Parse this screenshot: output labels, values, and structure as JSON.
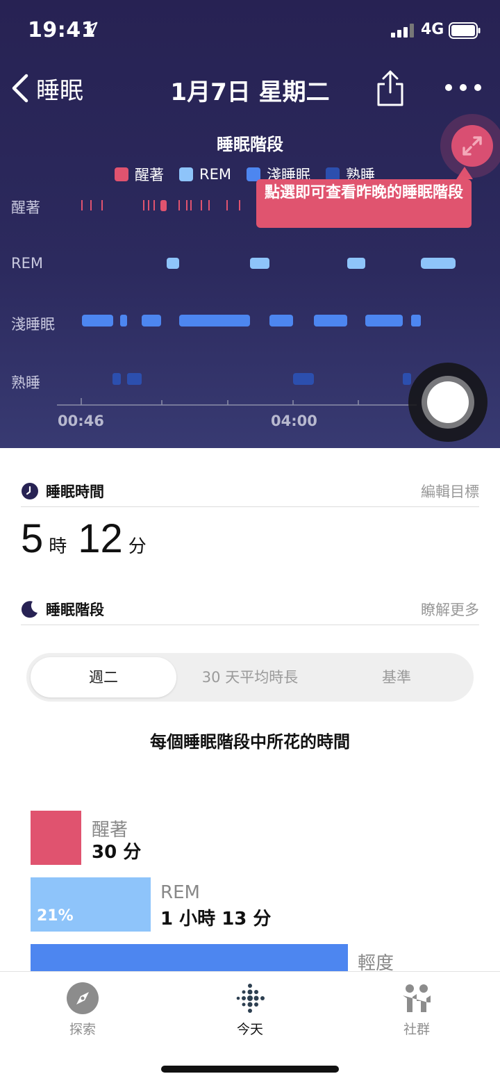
{
  "status_bar": {
    "time": "19:41",
    "network": "4G"
  },
  "nav": {
    "back_label": "睡眠",
    "title": "1月7日 星期二"
  },
  "hypnogram": {
    "title": "睡眠階段",
    "legend": [
      {
        "label": "醒著",
        "color": "#e0536f"
      },
      {
        "label": "REM",
        "color": "#8ec4fa"
      },
      {
        "label": "淺睡眠",
        "color": "#4d86f0"
      },
      {
        "label": "熟睡",
        "color": "#2c4fae"
      }
    ],
    "stage_labels": [
      "醒著",
      "REM",
      "淺睡眠",
      "熟睡"
    ],
    "time_ticks": [
      "00:46",
      "04:00"
    ],
    "tooltip": "點選即可查看昨晚的睡眠階段"
  },
  "sleep_time": {
    "title": "睡眠時間",
    "link": "編輯目標",
    "hours": "5",
    "hours_unit": "時",
    "minutes": "12",
    "minutes_unit": "分"
  },
  "sleep_stages": {
    "title": "睡眠階段",
    "link": "瞭解更多",
    "tabs": [
      "週二",
      "30 天平均時長",
      "基準"
    ],
    "chart_title": "每個睡眠階段中所花的時間",
    "bars": [
      {
        "name": "醒著",
        "value": "30 分",
        "percent": "",
        "color": "#e0536f"
      },
      {
        "name": "REM",
        "value": "1 小時 13 分",
        "percent": "21%",
        "color": "#8ec4fa"
      },
      {
        "name": "輕度",
        "value": "",
        "percent": "",
        "color": "#4d86f0"
      }
    ]
  },
  "tab_bar": {
    "items": [
      "探索",
      "今天",
      "社群"
    ],
    "active": "今天"
  }
}
